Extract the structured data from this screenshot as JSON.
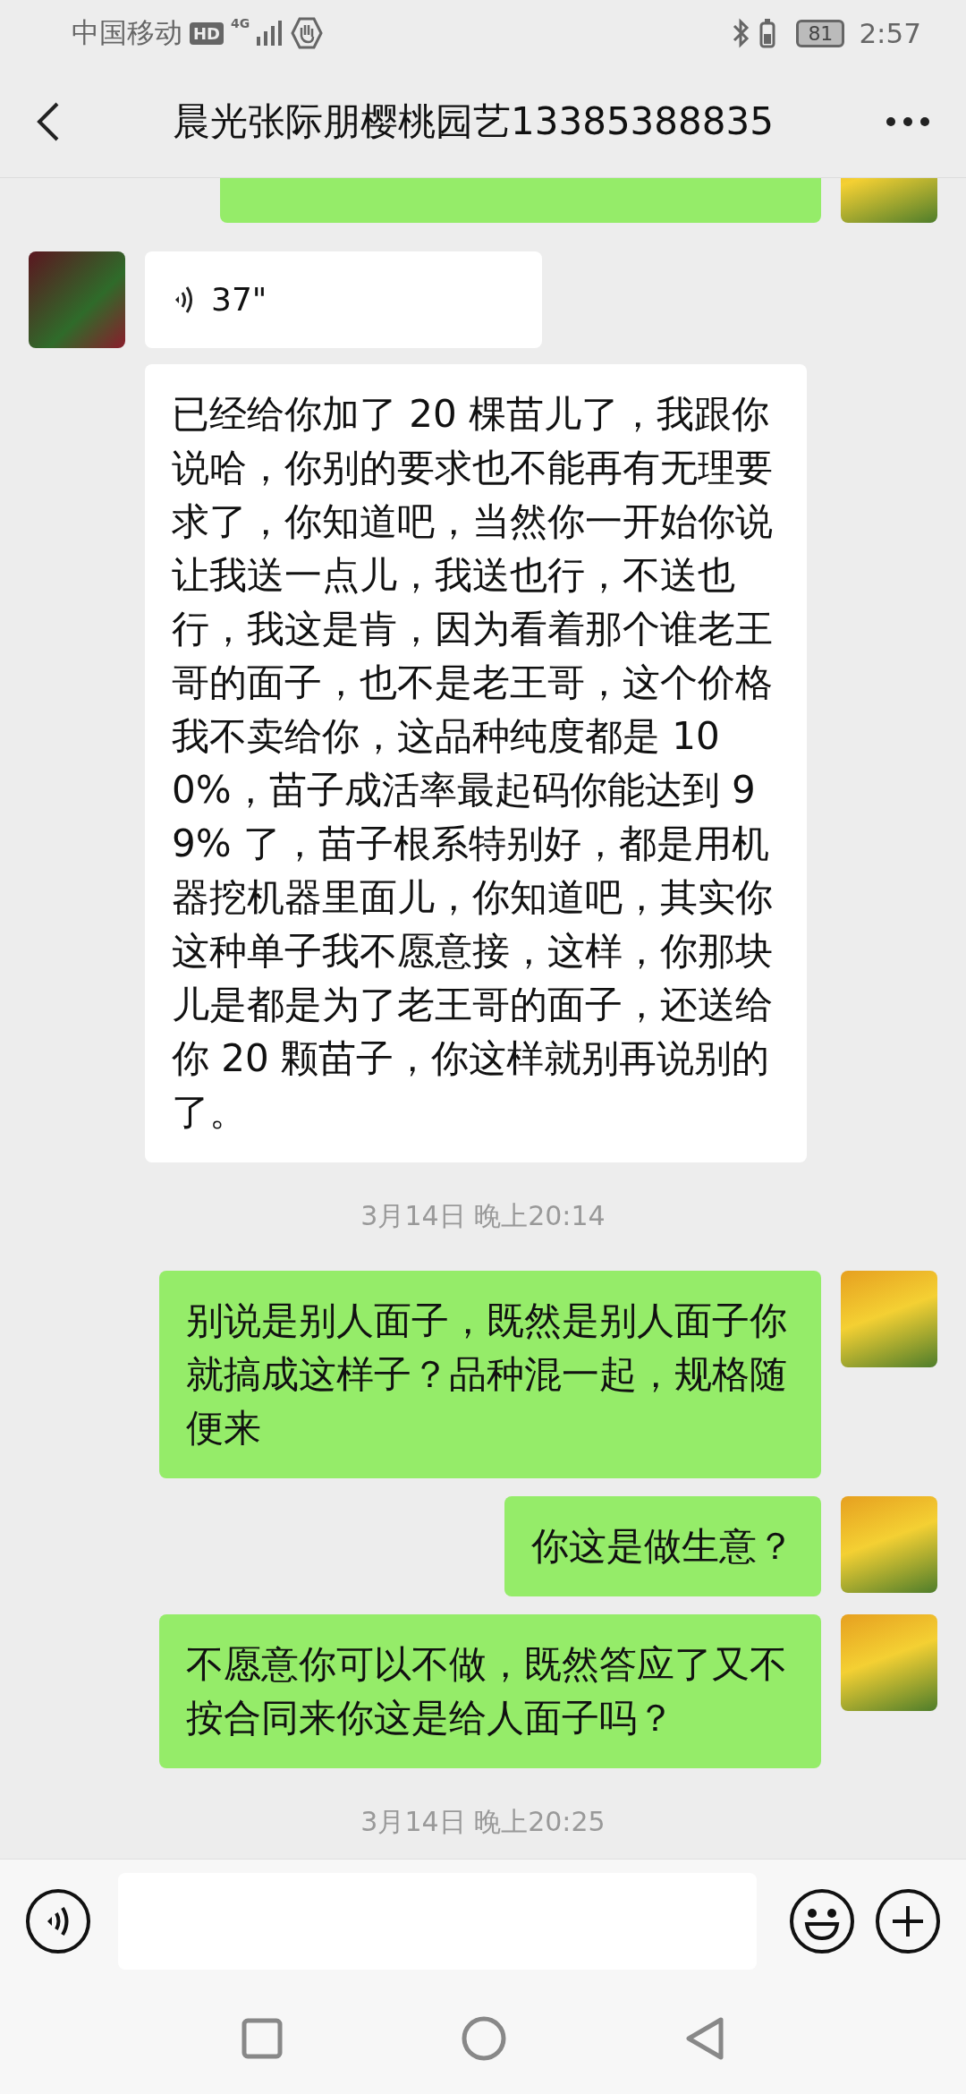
{
  "status_bar": {
    "carrier": "中国移动",
    "hd_badge": "HD",
    "network": "4G",
    "battery": "81",
    "time": "2:57"
  },
  "header": {
    "title": "晨光张际朋樱桃园艺13385388835"
  },
  "messages": [
    {
      "kind": "partial"
    },
    {
      "kind": "voice",
      "duration": "37\""
    },
    {
      "kind": "followup",
      "text": "已经给你加了 20 棵苗儿了，我跟你说哈，你别的要求也不能再有无理要求了，你知道吧，当然你一开始你说让我送一点儿，我送也行，不送也行，我这是肯，因为看着那个谁老王哥的面子，也不是老王哥，这个价格我不卖给你，这品种纯度都是 100%，苗子成活率最起码你能达到 99% 了，苗子根系特别好，都是用机器挖机器里面儿，你知道吧，其实你这种单子我不愿意接，这样，你那块儿是都是为了老王哥的面子，还送给你 20 颗苗子，你这样就别再说别的了。"
    },
    {
      "kind": "time",
      "text": "3月14日 晚上20:14"
    },
    {
      "kind": "outgoing",
      "text": "别说是别人面子，既然是别人面子你就搞成这样子？品种混一起，规格随便来"
    },
    {
      "kind": "outgoing",
      "text": "你这是做生意？"
    },
    {
      "kind": "outgoing",
      "text": "不愿意你可以不做，既然答应了又不按合同来你这是给人面子吗？"
    },
    {
      "kind": "time",
      "text": "3月14日 晚上20:25"
    }
  ]
}
